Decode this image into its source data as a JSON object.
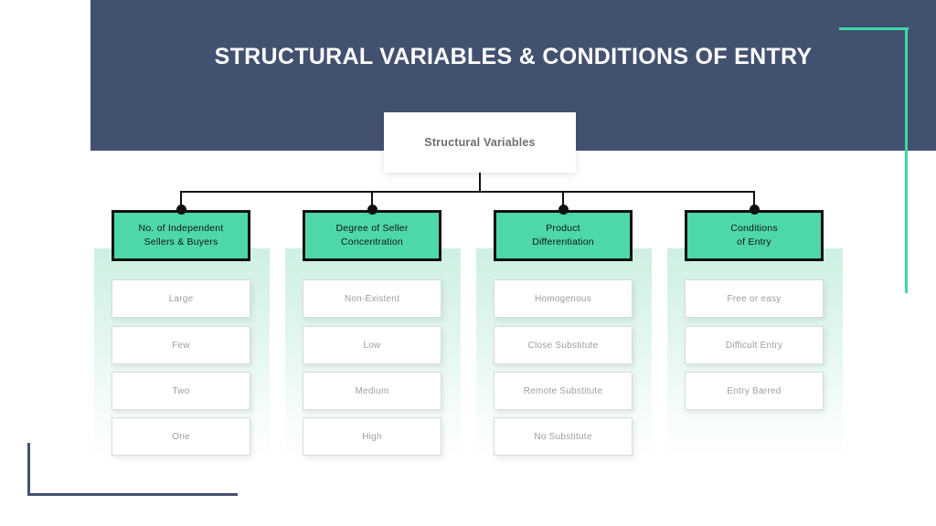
{
  "slide": {
    "title": "STRUCTURAL VARIABLES & CONDITIONS OF ENTRY",
    "root_node": "Structural Variables"
  },
  "colors": {
    "header_navy": "#435170",
    "accent_green": "#3fd7a4",
    "category_green": "#4ed8a8",
    "panel_mint": "#cdf0e1",
    "item_text": "#9a9da1",
    "title_text": "#ffffff"
  },
  "columns": [
    {
      "category_line1": "No. of Independent",
      "category_line2": "Sellers & Buyers",
      "items": [
        "Large",
        "Few",
        "Two",
        "One"
      ]
    },
    {
      "category_line1": "Degree of Seller",
      "category_line2": "Concentration",
      "items": [
        "Non-Existent",
        "Low",
        "Medium",
        "High"
      ]
    },
    {
      "category_line1": "Product",
      "category_line2": "Differentiation",
      "items": [
        "Homogenous",
        "Close Substitute",
        "Remote Substitute",
        "No Substitute"
      ]
    },
    {
      "category_line1": "Conditions",
      "category_line2": "of Entry",
      "items": [
        "Free or easy",
        "Difficult Entry",
        "Entry Barred"
      ]
    }
  ]
}
